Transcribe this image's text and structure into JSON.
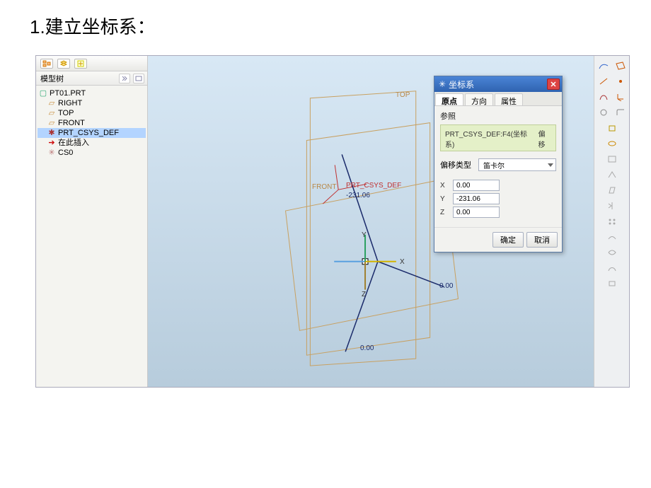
{
  "page_title": "1.建立坐标系：",
  "tree": {
    "header": "模型树",
    "root": "PT01.PRT",
    "items": [
      "RIGHT",
      "TOP",
      "FRONT",
      "PRT_CSYS_DEF",
      "在此插入",
      "CS0"
    ],
    "selected_index": 3
  },
  "canvas": {
    "labels": {
      "top": "TOP",
      "front": "FRONT",
      "csys": "PRT_CSYS_DEF",
      "dim_y": "-231.06",
      "axis_x": "X",
      "axis_y": "Y",
      "axis_z": "Z",
      "zero1": "0.00",
      "zero2": "0.00"
    }
  },
  "dialog": {
    "title": "坐标系",
    "tabs": [
      "原点",
      "方向",
      "属性"
    ],
    "active_tab": 0,
    "ref_label": "参照",
    "ref_item": "PRT_CSYS_DEF:F4(坐标系)",
    "ref_action": "偏移",
    "type_label": "偏移类型",
    "type_value": "笛卡尔",
    "coords": {
      "x_label": "X",
      "x": "0.00",
      "y_label": "Y",
      "y": "-231.06",
      "z_label": "Z",
      "z": "0.00"
    },
    "ok": "确定",
    "cancel": "取消"
  }
}
